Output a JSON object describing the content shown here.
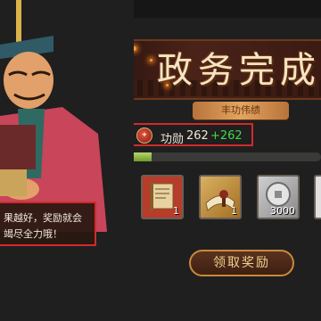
{
  "banner": {
    "title": "政务完成",
    "subtitle": "丰功伟绩"
  },
  "merit": {
    "label": "功勋",
    "value": "262",
    "gain": "+262",
    "icon": "merit-medal-icon",
    "progress": 0.12
  },
  "rewards": [
    {
      "icon": "decree-scroll-icon",
      "count": "1"
    },
    {
      "icon": "painting-scroll-icon",
      "count": "1"
    },
    {
      "icon": "silver-coin-icon",
      "count": "3000"
    },
    {
      "icon": "reward-item-icon",
      "count": ""
    }
  ],
  "dialog": {
    "line1": "果越好，奖励就会",
    "line2": "竭尽全力哦！"
  },
  "claim_button": {
    "label": "领取奖励"
  },
  "colors": {
    "highlight_border": "#d22a2a",
    "gain_green": "#3fda4a",
    "banner_text": "#f3e6c2"
  }
}
